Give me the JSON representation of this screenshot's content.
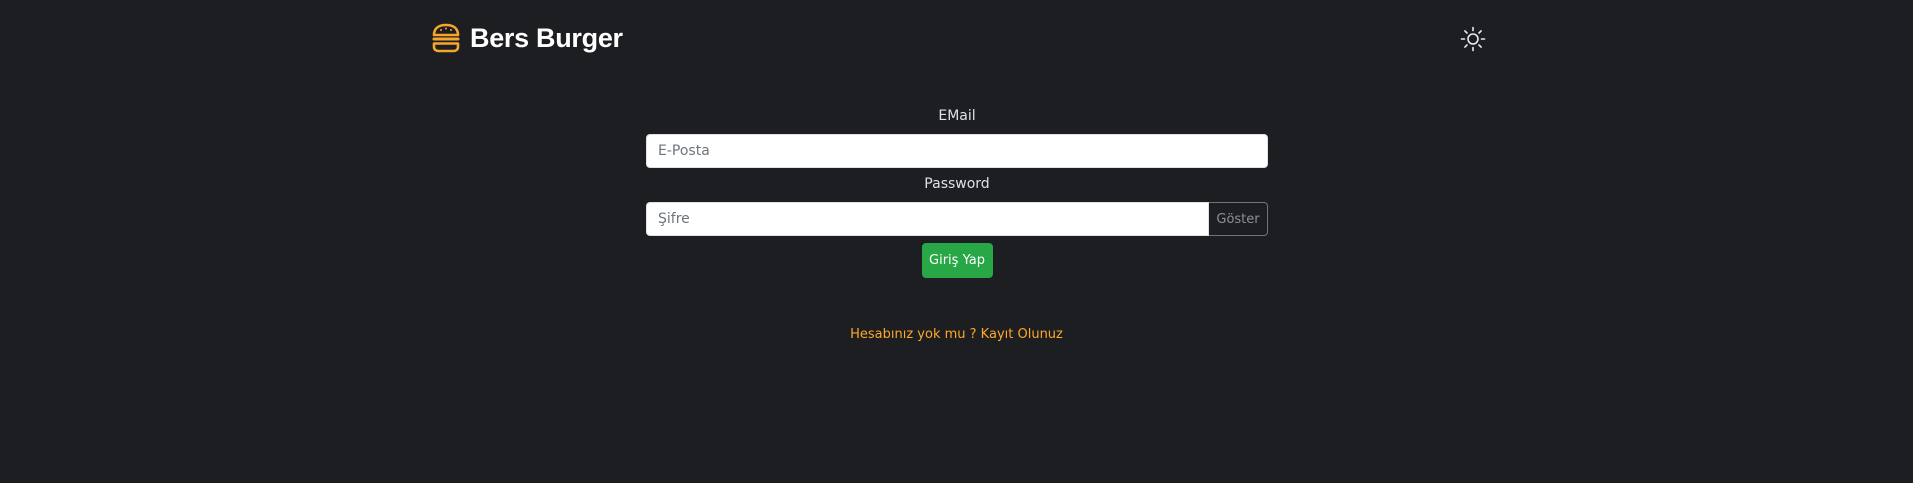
{
  "brand": {
    "name": "Bers Burger",
    "icon": "burger-icon",
    "color": "#f6a72a"
  },
  "header": {
    "theme_toggle_icon": "sun-icon"
  },
  "login_form": {
    "email_label": "EMail",
    "email_placeholder": "E-Posta",
    "email_value": "",
    "password_label": "Password",
    "password_placeholder": "Şifre",
    "password_value": "",
    "show_button_label": "Göster",
    "submit_label": "Giriş Yap"
  },
  "register_link": "Hesabınız yok mu ? Kayıt Olunuz",
  "colors": {
    "background": "#1d1e22",
    "submit": "#27a745",
    "link": "#ffa726"
  }
}
